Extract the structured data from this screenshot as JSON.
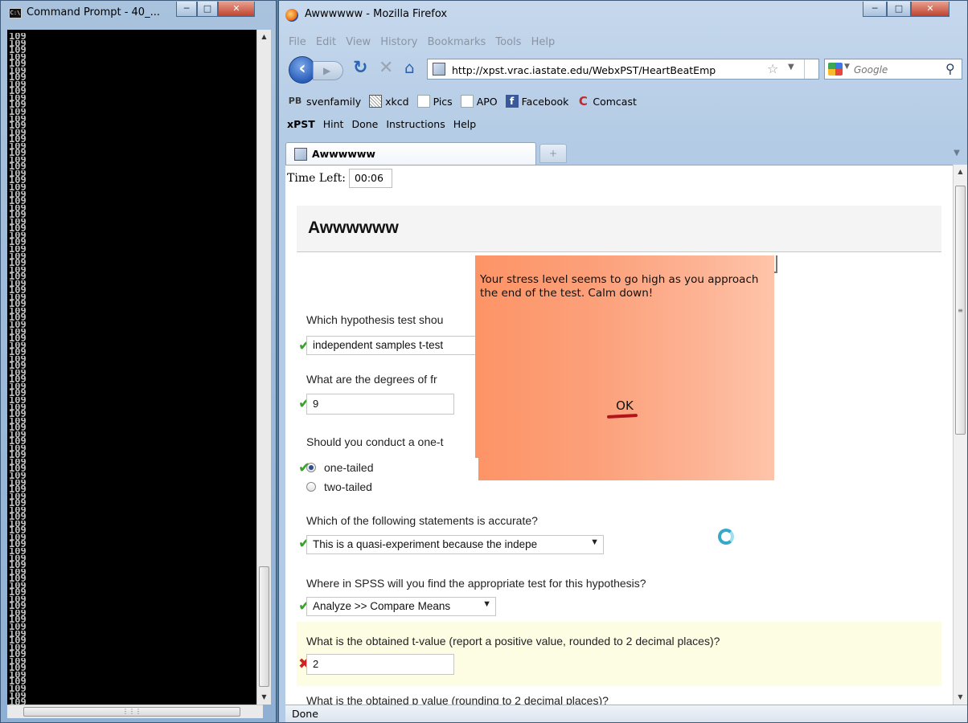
{
  "cmd": {
    "title": "Command Prompt - 40_...",
    "line_text": "109",
    "line_count": 98,
    "app_icon_label": "C:\\"
  },
  "firefox": {
    "title": "Awwwwww - Mozilla Firefox",
    "menu": [
      "File",
      "Edit",
      "View",
      "History",
      "Bookmarks",
      "Tools",
      "Help"
    ],
    "url": "http://xpst.vrac.iastate.edu/WebxPST/HeartBeatEmp",
    "search_placeholder": "Google",
    "bookmarks": [
      {
        "label": "svenfamily",
        "icon": "pb-icon",
        "glyph": "PB"
      },
      {
        "label": "xkcd",
        "icon": "xkcd-icon",
        "glyph": ""
      },
      {
        "label": "Pics",
        "icon": "page-icon",
        "glyph": ""
      },
      {
        "label": "APO",
        "icon": "page-icon",
        "glyph": ""
      },
      {
        "label": "Facebook",
        "icon": "facebook-icon",
        "glyph": "f"
      },
      {
        "label": "Comcast",
        "icon": "comcast-icon",
        "glyph": "C"
      }
    ],
    "xpst_toolbar": {
      "brand": "xPST",
      "items": [
        "Hint",
        "Done",
        "Instructions",
        "Help"
      ]
    },
    "tab": {
      "label": "Awwwwww",
      "new_tab_glyph": "+"
    },
    "status": "Done"
  },
  "page": {
    "time_left_label": "Time Left:",
    "time_left_value": "00:06",
    "title": "Awwwwww",
    "questions": [
      {
        "id": "q1",
        "label": "Which hypothesis test shou",
        "status": "correct",
        "answer": "independent samples t-test"
      },
      {
        "id": "q2",
        "label": "What are the degrees of fr",
        "status": "correct",
        "answer": "9"
      },
      {
        "id": "q3",
        "label": "Should you conduct a one-t",
        "status": "correct",
        "options": [
          "one-tailed",
          "two-tailed"
        ],
        "selected": "one-tailed"
      },
      {
        "id": "q4",
        "label": "Which of the following statements is accurate?",
        "status": "correct",
        "answer": "This is a quasi-experiment because the indepe"
      },
      {
        "id": "q5",
        "label": "Where in SPSS will you find the appropriate test for this hypothesis?",
        "status": "correct",
        "answer": "Analyze >> Compare Means"
      },
      {
        "id": "q6",
        "label": "What is the obtained t-value (report a positive value, rounded to 2 decimal places)?",
        "status": "incorrect",
        "answer": "2"
      },
      {
        "id": "q7",
        "label": "What is the obtained p value (rounding to 2 decimal places)?",
        "status": "unanswered"
      }
    ]
  },
  "popup": {
    "message": "Your stress level seems to go high as you approach the end of the test. Calm down!",
    "ok_label": "OK"
  },
  "colors": {
    "correct": "#3aa22a",
    "incorrect": "#d42020",
    "popup_start": "#fd9466",
    "popup_end": "#fec4aa",
    "highlight": "#fdfde3"
  }
}
